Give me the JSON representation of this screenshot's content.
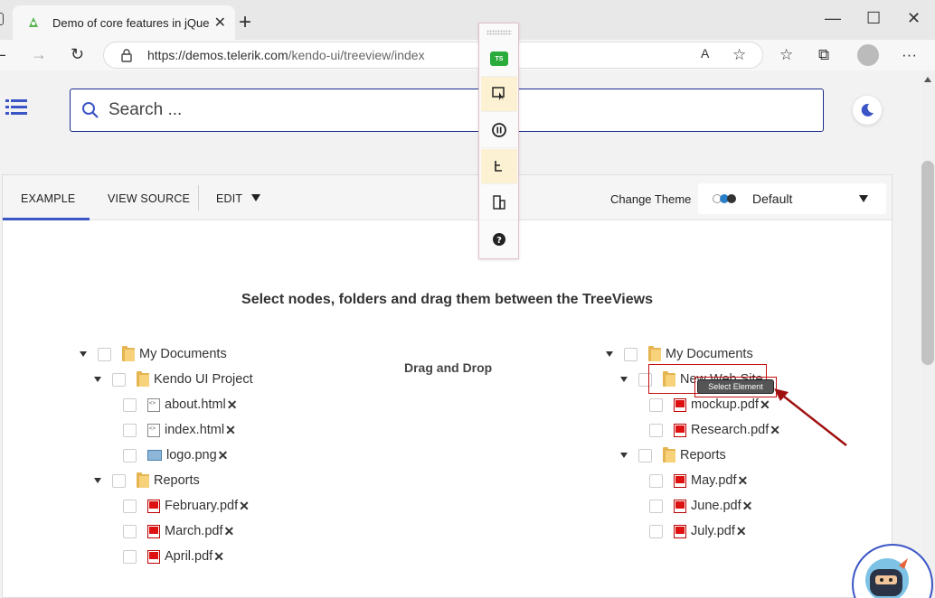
{
  "browser": {
    "tab_title": "Demo of core features in jQuery",
    "url_host": "https://demos.telerik.com",
    "url_path": "/kendo-ui/treeview/index"
  },
  "header": {
    "search_placeholder": "Search ..."
  },
  "demo_tabs": {
    "example": "EXAMPLE",
    "view_source": "VIEW SOURCE",
    "edit": "EDIT",
    "change_theme_label": "Change Theme",
    "theme_value": "Default"
  },
  "content": {
    "headline": "Select nodes, folders and drag them between the TreeViews",
    "dnd_label": "Drag and Drop"
  },
  "left_tree": {
    "my_documents": "My Documents",
    "kendo_project": "Kendo UI Project",
    "about": "about.html",
    "index": "index.html",
    "logo": "logo.png",
    "reports": "Reports",
    "february": "February.pdf",
    "march": "March.pdf",
    "april": "April.pdf"
  },
  "right_tree": {
    "my_documents": "My Documents",
    "new_web_site": "New Web Site",
    "mockup": "mockup.pdf",
    "research": "Research.pdf",
    "reports": "Reports",
    "may": "May.pdf",
    "june": "June.pdf",
    "july": "July.pdf"
  },
  "overlay": {
    "tooltip": "Select Element",
    "toolbar_logo": "TS"
  },
  "colors": {
    "accent": "#3b55c6",
    "annotation_red": "#c21010",
    "folder": "#e5b552"
  },
  "icons": [
    "tab-favicon",
    "close-icon",
    "plus-icon",
    "minimize-icon",
    "maximize-icon",
    "back-icon",
    "forward-icon",
    "refresh-icon",
    "lock-icon",
    "read-aloud-icon",
    "favorite-add-icon",
    "favorites-icon",
    "collections-icon",
    "profile-icon",
    "more-icon",
    "menu-icon",
    "search-icon",
    "moon-icon",
    "select-element-icon",
    "pause-icon",
    "tree-icon",
    "split-icon",
    "help-icon"
  ]
}
